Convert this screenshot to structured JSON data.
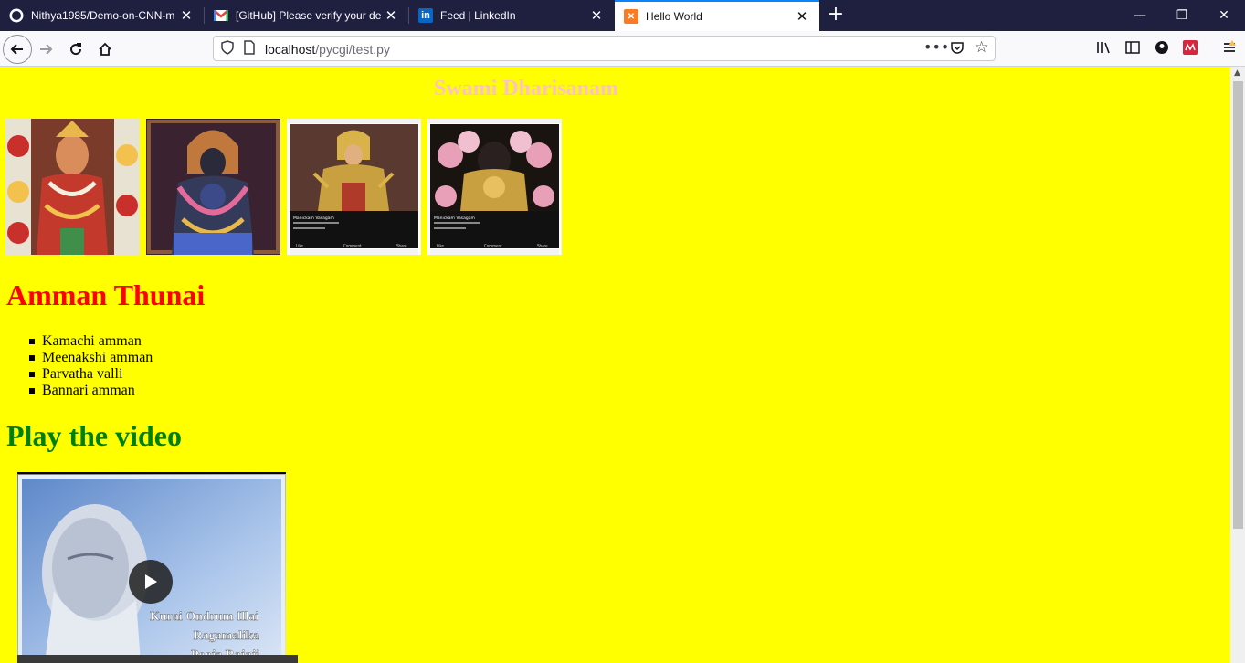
{
  "browser": {
    "tabs": [
      {
        "title": "Nithya1985/Demo-on-CNN-m",
        "active": false,
        "icon": "github-icon"
      },
      {
        "title": "[GitHub] Please verify your dev",
        "active": false,
        "icon": "gmail-icon"
      },
      {
        "title": "Feed | LinkedIn",
        "active": false,
        "icon": "linkedin-icon"
      },
      {
        "title": "Hello World",
        "active": true,
        "icon": "xampp-icon"
      }
    ],
    "url_host": "localhost",
    "url_path": "/pycgi/test.py"
  },
  "page": {
    "background_color": "#ffff00",
    "caption": "Swami Dharisanam",
    "images": [
      {
        "alt": "Amman idol decorated with flower garlands"
      },
      {
        "alt": "Dark stone deity idol with garlands"
      },
      {
        "alt": "Phone screenshot of golden deity idol"
      },
      {
        "alt": "Phone screenshot of deity idol with lotus flowers"
      }
    ],
    "screenshot_overlay": {
      "name": "Manickam Vasagam",
      "actions": [
        "Like",
        "Comment",
        "Share"
      ]
    },
    "heading_amman": "Amman Thunai",
    "heading_amman_color": "#ff0000",
    "deities": [
      "Kamachi amman",
      "Meenakshi amman",
      "Parvatha valli",
      "Bannari amman"
    ],
    "heading_video": "Play the video",
    "heading_video_color": "#008000",
    "video": {
      "overlay_lines": [
        "Kurai Ondrum Illai",
        "Ragamalika",
        "Pooja Rajaji"
      ]
    }
  }
}
